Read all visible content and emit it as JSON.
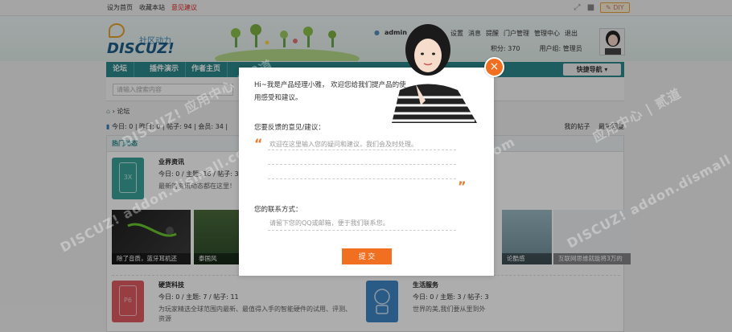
{
  "topbar": {
    "set_home": "设为首页",
    "bookmark": "收藏本站",
    "feedback": "意见建议",
    "diy": "DIY"
  },
  "header": {
    "logo_cn": "社区动力",
    "logo_en": "DISCUZ!",
    "username": "admin",
    "links": [
      "设置",
      "消息",
      "提醒",
      "门户管理",
      "管理中心",
      "退出"
    ],
    "points_label": "积分: 370",
    "usergroup_label": "用户组: 管理员"
  },
  "nav": {
    "items": [
      "论坛",
      "插件演示",
      "作者主页"
    ],
    "quick": "快捷导航"
  },
  "search": {
    "placeholder": "请输入搜索内容"
  },
  "breadcrumb": {
    "home_icon": "home-icon",
    "current": "论坛"
  },
  "stats": {
    "text": "今日: 0 | 昨日: 0 | 帖子: 94 | 会员: 34 |",
    "my_posts": "我的帖子",
    "latest": "最新回复"
  },
  "panel": {
    "title": "热门动态",
    "forums": [
      {
        "name": "业界资讯",
        "stats": "今日: 0 / 主题: 16 / 帖子: 38",
        "desc": "最新的资讯动态都在这里！",
        "icon_text": "3X",
        "color": "#3aa39a"
      },
      {
        "name": "硬货科技",
        "stats": "今日: 0 / 主题: 7 / 帖子: 11",
        "desc": "为玩家精选全球范围内最新、最值得入手的智能硬件的试用、评测、资源",
        "icon_text": "P6",
        "color": "#e05a62"
      },
      {
        "name": "生活服务",
        "stats": "今日: 0 / 主题: 3 / 帖子: 3",
        "desc": "世界的美,我们要从里到外",
        "icon_text": "",
        "color": "#3d86c6"
      }
    ],
    "thumbs": [
      {
        "caption": "除了音质，蓝牙耳机还"
      },
      {
        "caption": "泰国风"
      },
      {
        "caption": ""
      },
      {
        "caption": ""
      },
      {
        "caption": ""
      },
      {
        "caption": "论酷感"
      },
      {
        "caption": "互联网思维就能将3万的"
      }
    ]
  },
  "modal": {
    "greeting": "Hi~我是产品经理小雅， 欢迎您给我们提产品的使用感受和建议。",
    "question": "您要反馈的意见/建议：",
    "textarea_placeholder": "欢迎在这里输入您的疑问和建议，我们会及时处理。",
    "contact_label": "您的联系方式：",
    "contact_placeholder": "请留下您的QQ或邮箱，便于我们联系您。",
    "submit": "提 交",
    "close": "×"
  },
  "colors": {
    "accent": "#f06f20",
    "nav": "#2c8a8c"
  }
}
